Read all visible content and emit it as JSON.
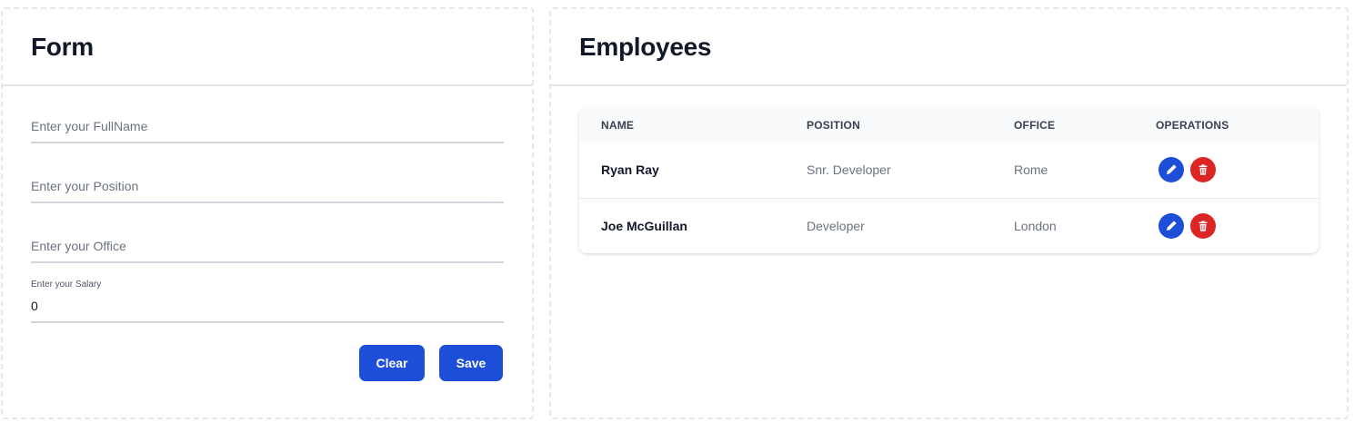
{
  "form": {
    "title": "Form",
    "fullname_placeholder": "Enter your FullName",
    "fullname_value": "",
    "position_placeholder": "Enter your Position",
    "position_value": "",
    "office_placeholder": "Enter your Office",
    "office_value": "",
    "salary_label": "Enter your Salary",
    "salary_value": "0",
    "clear_label": "Clear",
    "save_label": "Save"
  },
  "employees": {
    "title": "Employees",
    "columns": [
      "NAME",
      "POSITION",
      "OFFICE",
      "OPERATIONS"
    ],
    "rows": [
      {
        "name": "Ryan Ray",
        "position": "Snr. Developer",
        "office": "Rome"
      },
      {
        "name": "Joe McGuillan",
        "position": "Developer",
        "office": "London"
      }
    ],
    "edit_icon": "pencil-icon",
    "delete_icon": "trash-icon"
  },
  "colors": {
    "primary": "#1d4ed8",
    "danger": "#dc2626",
    "border_dashed": "#e5e7eb"
  }
}
